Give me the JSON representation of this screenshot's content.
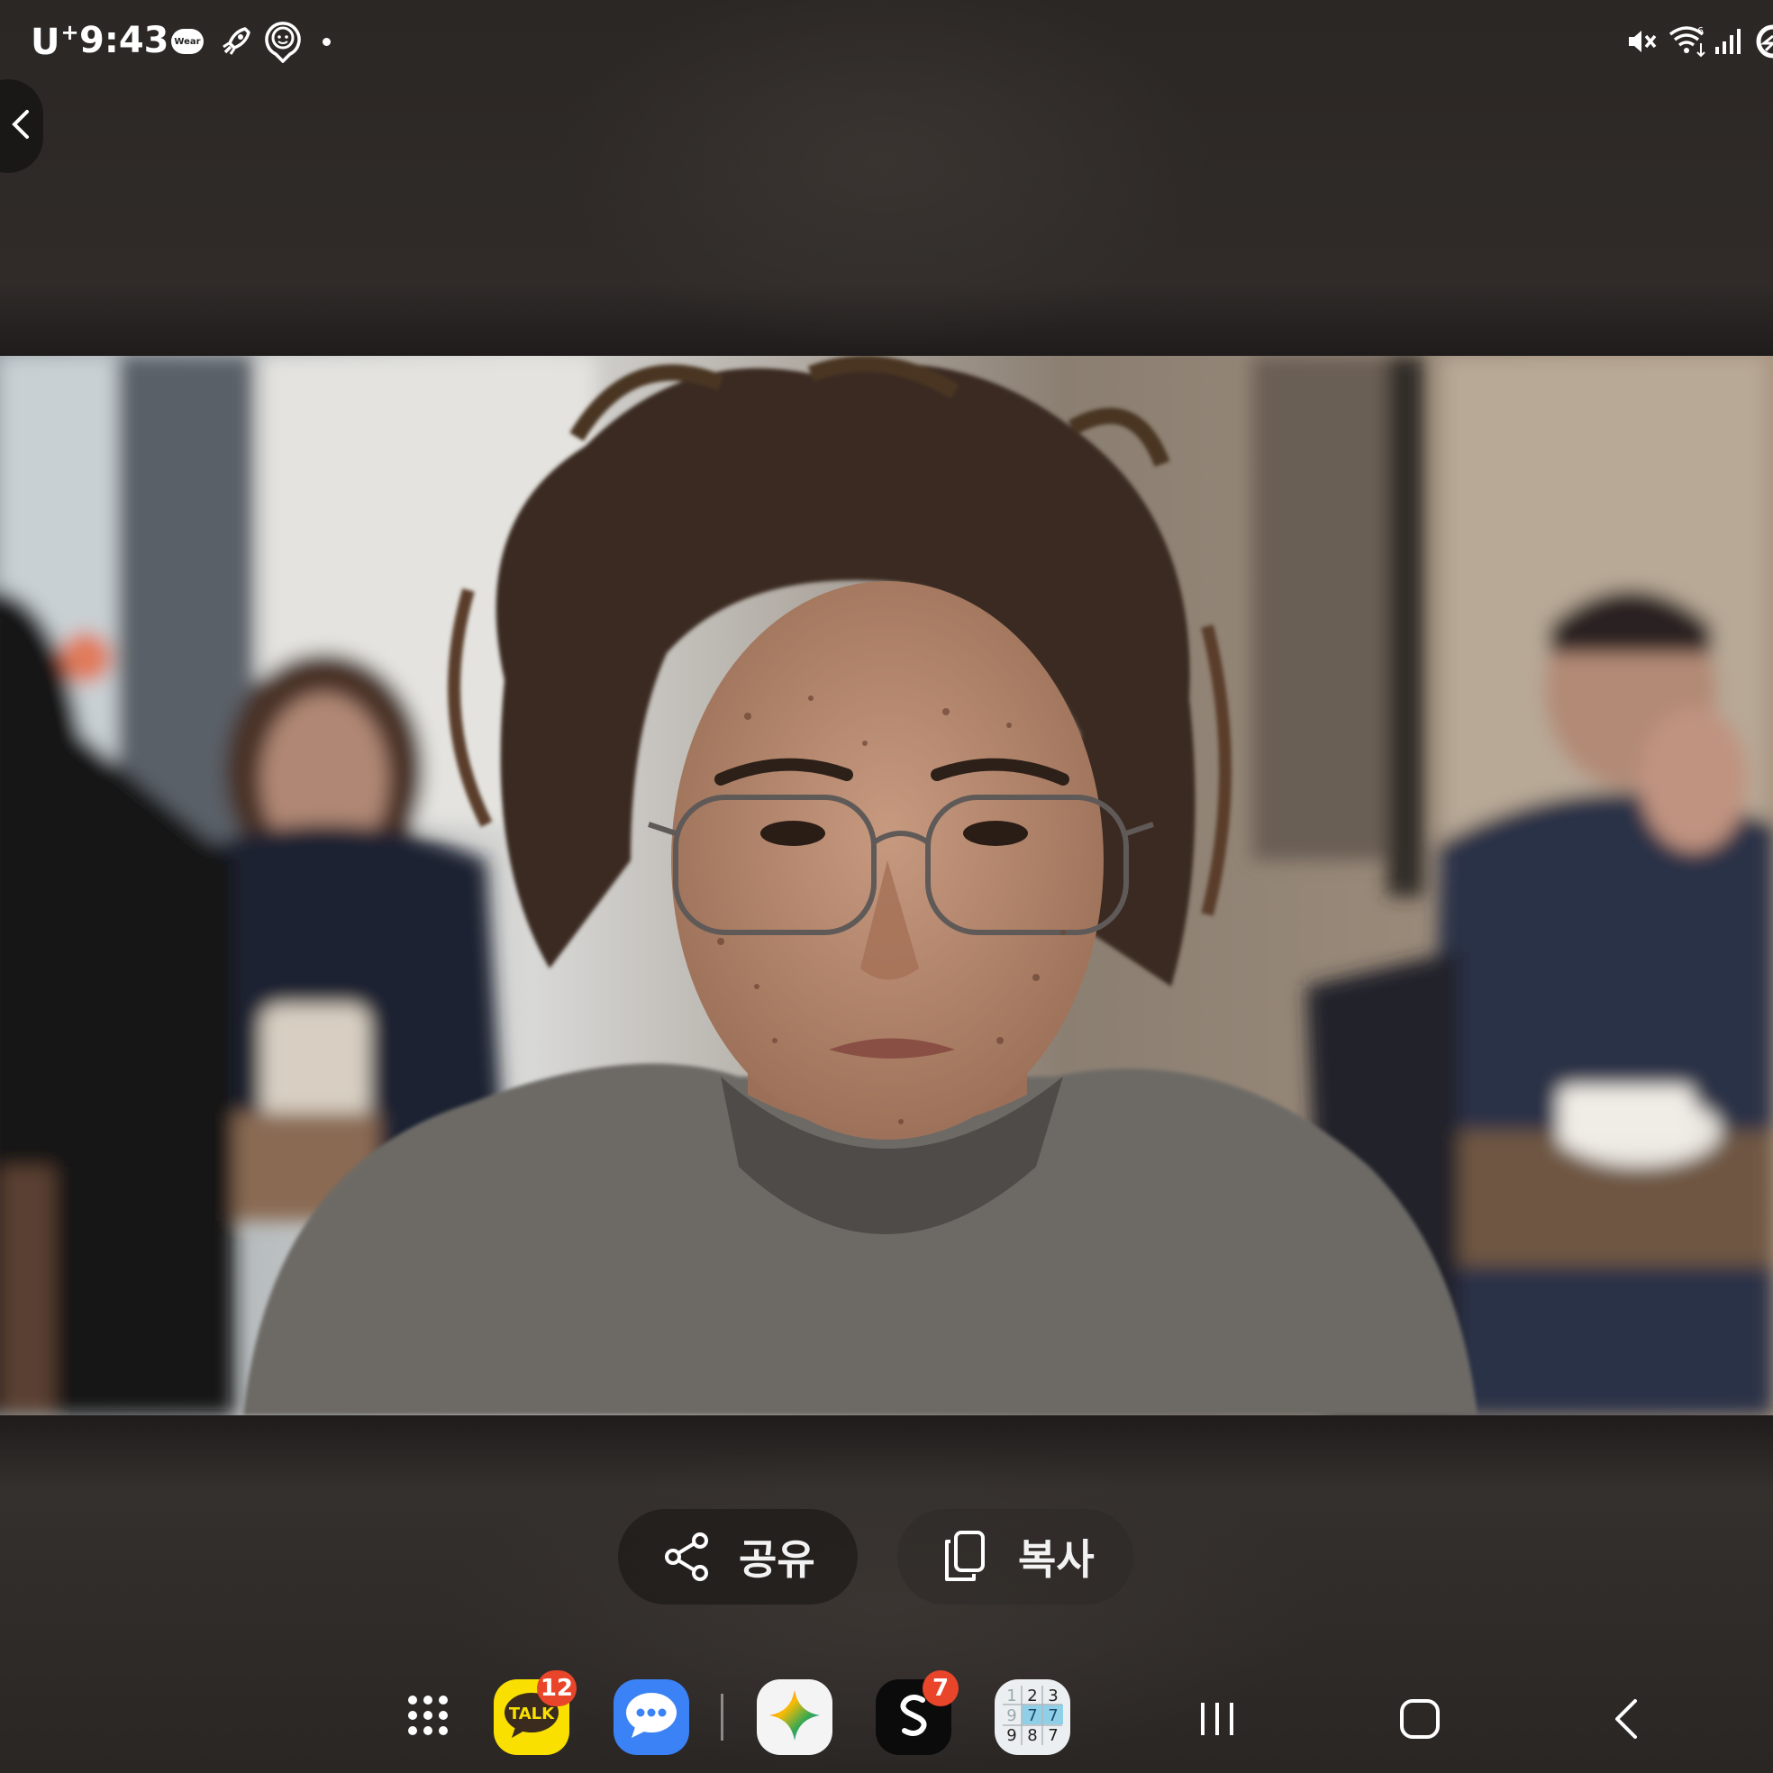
{
  "status_bar": {
    "carrier": "U",
    "carrier_sup": "+",
    "time": "9:43",
    "wear_label": "Wear",
    "icons": [
      "wear-icon",
      "rocket-icon",
      "watch-face-icon",
      "notification-dot-icon",
      "mute-icon",
      "wifi-icon",
      "signal-icon",
      "battery-icon"
    ]
  },
  "actions": {
    "share_label": "공유",
    "copy_label": "복사"
  },
  "taskbar": {
    "apps": [
      {
        "name": "apps-grid",
        "icon": "grid-icon"
      },
      {
        "name": "kakaotalk",
        "icon": "talk-icon",
        "label": "TALK",
        "badge": "12"
      },
      {
        "name": "messages",
        "icon": "chat-bubble-icon"
      },
      {
        "name": "gemini",
        "icon": "sparkle-icon"
      },
      {
        "name": "app-black",
        "icon": "s-logo-icon",
        "badge": "7"
      },
      {
        "name": "sudoku",
        "icon": "sudoku-icon",
        "digits": [
          "1",
          "2",
          "3",
          "9",
          "7",
          "7",
          "9",
          "8",
          "7"
        ]
      }
    ],
    "nav": [
      "recents-icon",
      "home-icon",
      "back-icon"
    ]
  },
  "colors": {
    "background": "#2a2624",
    "badge": "#e8452a",
    "kakao_yellow": "#f9e000",
    "messages_blue": "#3b82f6"
  }
}
